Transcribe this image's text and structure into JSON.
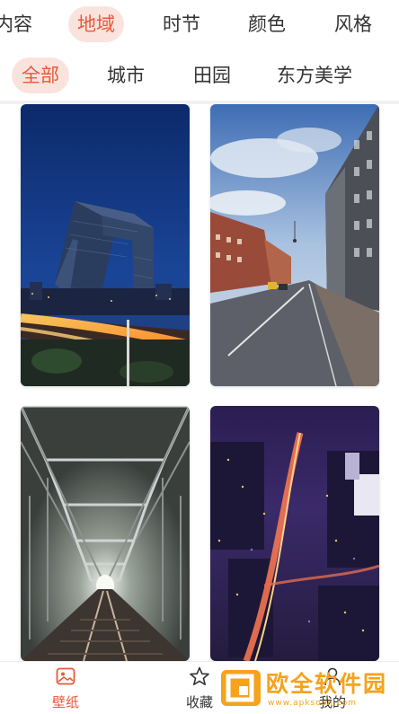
{
  "categories": [
    "内容",
    "地域",
    "时节",
    "颜色",
    "风格"
  ],
  "active_category": "地域",
  "subcategories": [
    "全部",
    "城市",
    "田园",
    "东方美学"
  ],
  "active_subcategory": "全部",
  "wallpapers": [
    {
      "name": "cctv-tower-night",
      "scene": "city-night-tower"
    },
    {
      "name": "european-street",
      "scene": "street-dusk"
    },
    {
      "name": "steel-bridge-railway",
      "scene": "bridge-tunnel"
    },
    {
      "name": "city-aerial-night",
      "scene": "aerial-night"
    }
  ],
  "tabbar": {
    "wallpaper": {
      "label": "壁纸",
      "icon": "image-icon"
    },
    "favorites": {
      "label": "收藏",
      "icon": "star-icon"
    },
    "mine": {
      "label": "我的",
      "icon": "person-icon"
    }
  },
  "colors": {
    "accent": "#e8583a",
    "accent_bg": "#fbe3dd",
    "watermark": "#f5a21d"
  },
  "watermark": {
    "text": "欧全软件园",
    "subtext": "www.apksoon.com"
  }
}
